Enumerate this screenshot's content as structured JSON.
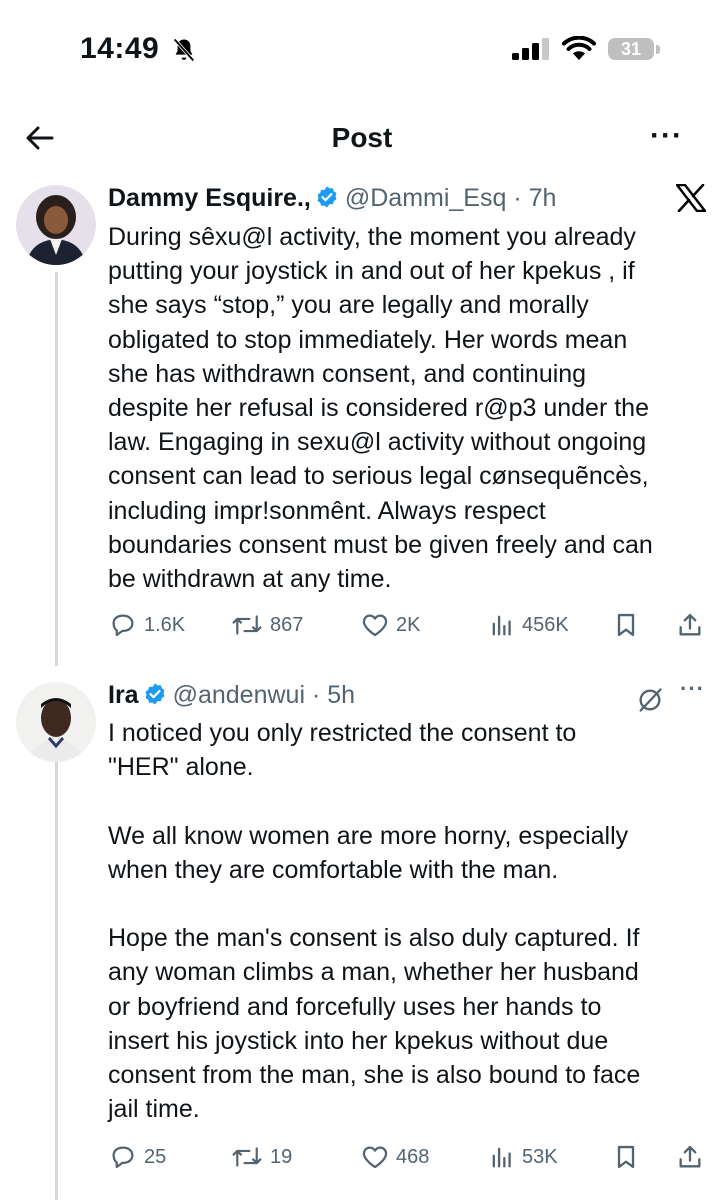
{
  "status_bar": {
    "time": "14:49",
    "battery": "31"
  },
  "nav": {
    "title": "Post"
  },
  "post": {
    "author_name": "Dammy Esquire.,",
    "handle_time": "@Dammi_Esq · 7h",
    "text": "During sêxu@l activity, the moment you already\nputting your joystick in and out of her kpekus , if\nshe says “stop,” you are legally and morally\nobligated to stop immediately. Her words mean\nshe has withdrawn consent, and continuing\ndespite her refusal is considered r@p3 under the\nlaw. Engaging in sexu@l activity without ongoing\nconsent can lead to serious legal cønsequẽncès,\nincluding impr!sonmênt. Always respect\nboundaries consent must be given freely and can\nbe withdrawn at any time.",
    "stats": {
      "replies": "1.6K",
      "reposts": "867",
      "likes": "2K",
      "views": "456K"
    }
  },
  "reply": {
    "author_name": "Ira",
    "handle_time": "@andenwui · 5h",
    "text": "I noticed you only restricted the consent to\n\"HER\" alone.\n\nWe all know women are more horny, especially\nwhen they are comfortable with the man.\n\nHope the man's consent is also duly captured. If\nany woman climbs a man, whether her husband\nor boyfriend and forcefully uses her hands to\ninsert his joystick into her kpekus without due\nconsent from the man, she is also bound to face\njail time.",
    "stats": {
      "replies": "25",
      "reposts": "19",
      "likes": "468",
      "views": "53K"
    }
  },
  "icons": {
    "back": "back-arrow-icon",
    "more": "more-horizontal-icon",
    "verified": "verified-badge-icon",
    "x_logo": "x-logo-icon",
    "grok": "grok-icon",
    "reply": "reply-icon",
    "repost": "repost-icon",
    "like": "like-icon",
    "views": "views-icon",
    "bookmark": "bookmark-icon",
    "share": "share-icon"
  },
  "colors": {
    "verified": "#1d9bf0",
    "text": "#0f1419",
    "secondary": "#536471",
    "line": "#cfd9de"
  }
}
